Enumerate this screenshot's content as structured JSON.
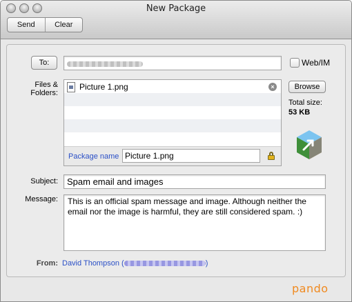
{
  "window": {
    "title": "New Package"
  },
  "toolbar": {
    "send_label": "Send",
    "clear_label": "Clear"
  },
  "to": {
    "button_label": "To:",
    "web_im_label": "Web/IM"
  },
  "files": {
    "label_line1": "Files &",
    "label_line2": "Folders:",
    "items": [
      {
        "name": "Picture 1.png"
      }
    ],
    "browse_label": "Browse",
    "total_size_label": "Total size:",
    "total_size_value": "53 KB",
    "package_name_label": "Package name",
    "package_name_value": "Picture 1.png"
  },
  "subject": {
    "label": "Subject:",
    "value": "Spam email and images"
  },
  "message": {
    "label": "Message:",
    "value": "This is an official spam message and image. Although neither the email nor the image is harmful, they are still considered spam. :)"
  },
  "from": {
    "label": "From:",
    "name": "David Thompson",
    "open_paren": "(",
    "close_paren": ")"
  },
  "brand": {
    "name": "pando",
    "color": "#f08a20"
  },
  "colors": {
    "link": "#2a4fc6"
  }
}
